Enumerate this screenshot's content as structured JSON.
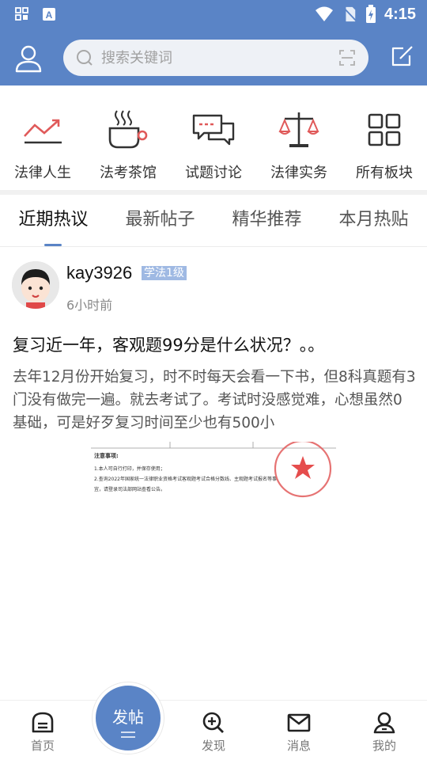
{
  "status_bar": {
    "time": "4:15"
  },
  "header": {
    "search_placeholder": "搜索关键词",
    "accent": "#5a84c6"
  },
  "categories": [
    {
      "label": "法律人生",
      "icon": "trend-line-icon",
      "color": "#e05a5a"
    },
    {
      "label": "法考茶馆",
      "icon": "tea-cup-icon",
      "color": "#e05a5a"
    },
    {
      "label": "试题讨论",
      "icon": "chat-bubbles-icon",
      "color": "#e05a5a"
    },
    {
      "label": "法律实务",
      "icon": "scales-icon",
      "color": "#e05a5a"
    },
    {
      "label": "所有板块",
      "icon": "grid-icon",
      "color": "#333333"
    }
  ],
  "tabs": [
    {
      "label": "近期热议",
      "active": true
    },
    {
      "label": "最新帖子",
      "active": false
    },
    {
      "label": "精华推荐",
      "active": false
    },
    {
      "label": "本月热贴",
      "active": false
    }
  ],
  "post": {
    "username": "kay3926",
    "level": "学法1级",
    "time": "6小时前",
    "title": "复习近一年，客观题99分是什么状况？。。",
    "body": "去年12月份开始复习，时不时每天会看一下书，但8科真题有3门没有做完一遍。就去考试了。考试时没感觉难，心想虽然0基础，可是好歹复习时间至少也有500小",
    "image": {
      "note_title": "注意事项:",
      "note_1": "1.本人可自行打印，并保存使用；",
      "note_2": "2.查询2022年国家统一法律职业资格考试客观题考试合格分数线、主观题考试报名等事",
      "note_3": "宜，请登录司法部网站查看公告。"
    }
  },
  "bottom_nav": [
    {
      "label": "首页",
      "icon": "home-icon"
    },
    {
      "label": "发现",
      "icon": "discover-icon"
    },
    {
      "label": "消息",
      "icon": "mail-icon"
    },
    {
      "label": "我的",
      "icon": "profile-icon"
    }
  ],
  "post_button": {
    "label": "发帖"
  }
}
